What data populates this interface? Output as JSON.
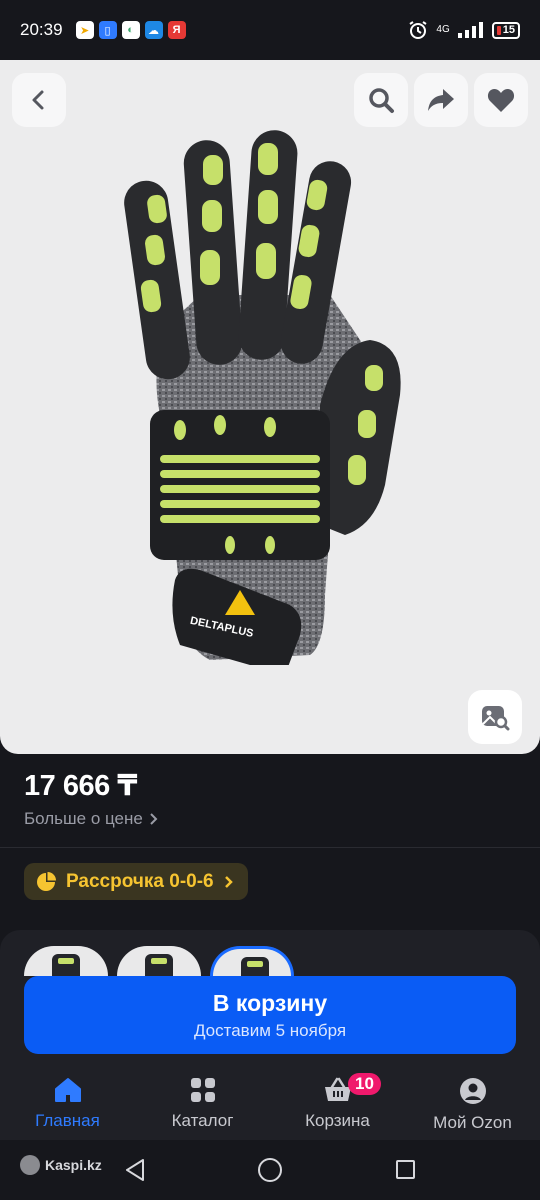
{
  "status_bar": {
    "time": "20:39",
    "network": "4G",
    "battery": "15"
  },
  "product": {
    "price": "17 666 ₸",
    "more_price": "Больше о цене",
    "installment": "Рассрочка 0-0-6",
    "image_logo_text": "DELTAPLUS"
  },
  "cart_button": {
    "title": "В корзину",
    "subtitle": "Доставим 5 ноября"
  },
  "tabs": [
    {
      "label": "Главная",
      "icon": "home-icon",
      "active": true
    },
    {
      "label": "Каталог",
      "icon": "catalog-icon",
      "active": false
    },
    {
      "label": "Корзина",
      "icon": "basket-icon",
      "active": false,
      "badge": "10"
    },
    {
      "label": "Мой Ozon",
      "icon": "profile-icon",
      "active": false
    }
  ],
  "system_nav": {
    "watermark": "Kaspi.kz"
  },
  "colors": {
    "background": "#16171c",
    "accent": "#0a5cf5",
    "active_tab": "#2f7bff",
    "installment_text": "#f6c431",
    "badge": "#f0196c"
  }
}
